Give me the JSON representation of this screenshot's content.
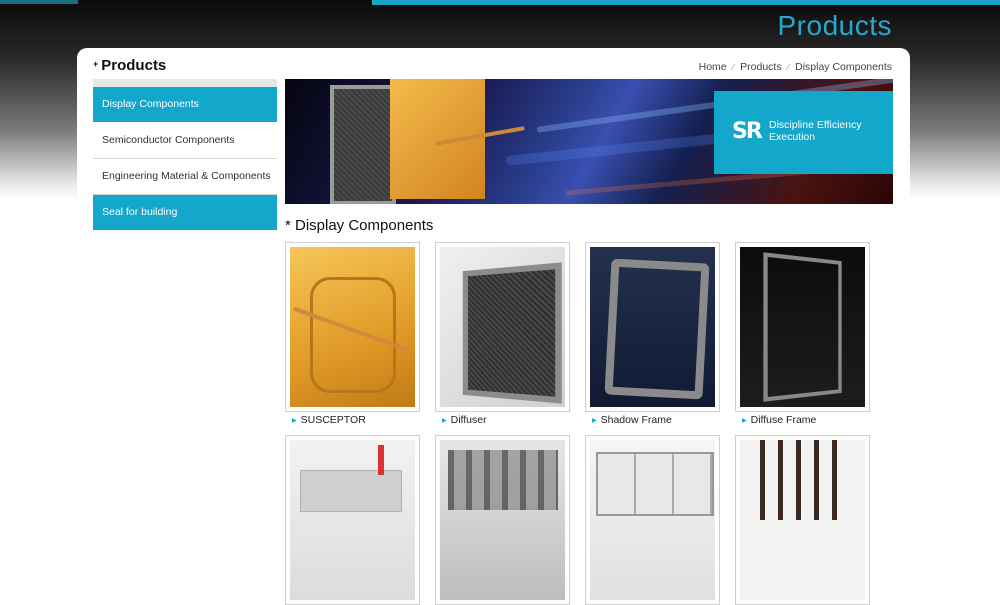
{
  "header": {
    "page_heading": "Products"
  },
  "section": {
    "title": "Products"
  },
  "breadcrumb": [
    {
      "label": "Home"
    },
    {
      "label": "Products"
    },
    {
      "label": "Display Components"
    }
  ],
  "sidebar": {
    "items": [
      {
        "label": "Display Components",
        "active": true
      },
      {
        "label": "Semiconductor Components",
        "active": false
      },
      {
        "label": "Engineering Material & Components",
        "active": false
      },
      {
        "label": "Seal for building",
        "active": true
      }
    ]
  },
  "banner": {
    "logo": "SR",
    "tagline": "Discipline Efficiency Execution",
    "accent_color": "#13a7cb"
  },
  "category": {
    "title": "* Display Components"
  },
  "products": [
    {
      "name": "SUSCEPTOR",
      "icon": "susceptor-image"
    },
    {
      "name": "Diffuser",
      "icon": "diffuser-image"
    },
    {
      "name": "Shadow Frame",
      "icon": "shadow-frame-image"
    },
    {
      "name": "Diffuse Frame",
      "icon": "diffuse-frame-image"
    },
    {
      "name": "",
      "icon": "equipment-image"
    },
    {
      "name": "",
      "icon": "equipment-image"
    },
    {
      "name": "",
      "icon": "equipment-image"
    },
    {
      "name": "",
      "icon": "equipment-image"
    }
  ],
  "colors": {
    "accent": "#13a7cb",
    "heading": "#27a8cc"
  }
}
